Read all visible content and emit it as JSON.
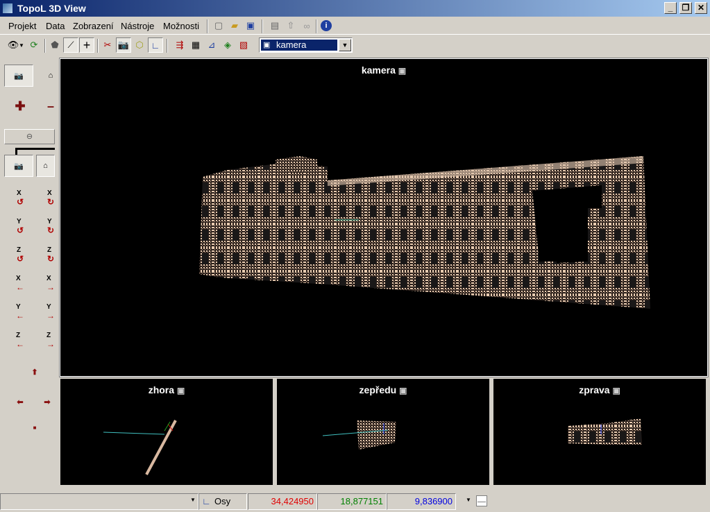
{
  "window": {
    "title": "TopoL 3D View"
  },
  "menu": {
    "items": [
      "Projekt",
      "Data",
      "Zobrazení",
      "Nástroje",
      "Možnosti"
    ]
  },
  "toolbar": {
    "view_combo_value": "kamera"
  },
  "views": {
    "main_title": "kamera",
    "top_title": "zhora",
    "front_title": "zepředu",
    "right_title": "zprava"
  },
  "left_panel": {
    "axis_labels": [
      "X",
      "X",
      "Y",
      "Y",
      "Z",
      "Z",
      "X",
      "X",
      "Y",
      "Y",
      "Z",
      "Z"
    ]
  },
  "status": {
    "axes_label": "Osy",
    "x_value": "34,424950",
    "y_value": "18,877151",
    "z_value": "9,836900"
  },
  "colors": {
    "x_value": "#e00000",
    "y_value": "#008000",
    "z_value": "#0000e0",
    "titlebar_start": "#0a246a",
    "titlebar_end": "#a6caf0"
  }
}
